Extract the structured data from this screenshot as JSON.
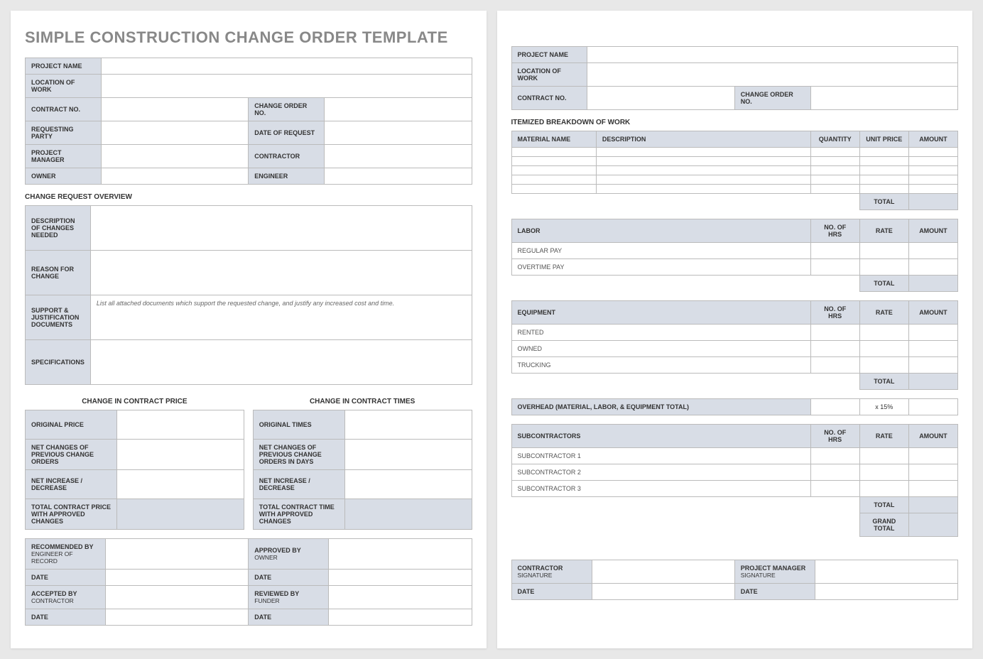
{
  "title": "SIMPLE CONSTRUCTION CHANGE ORDER TEMPLATE",
  "p1": {
    "projname": "PROJECT NAME",
    "loc": "LOCATION OF WORK",
    "contractno": "CONTRACT NO.",
    "changeno": "CHANGE ORDER NO.",
    "reqparty": "REQUESTING PARTY",
    "datereq": "DATE OF REQUEST",
    "pm": "PROJECT MANAGER",
    "contractor": "CONTRACTOR",
    "owner": "OWNER",
    "engineer": "ENGINEER"
  },
  "ov": {
    "h": "CHANGE REQUEST OVERVIEW",
    "desc": "DESCRIPTION OF CHANGES NEEDED",
    "reason": "REASON FOR CHANGE",
    "support": "SUPPORT & JUSTIFICATION DOCUMENTS",
    "supporthint": "List all attached documents which support the requested change, and justify any increased cost and time.",
    "spec": "SPECIFICATIONS"
  },
  "price": {
    "h": "CHANGE IN CONTRACT PRICE",
    "orig": "ORIGINAL PRICE",
    "net": "NET CHANGES OF PREVIOUS CHANGE ORDERS",
    "inc": "NET INCREASE / DECREASE",
    "tot": "TOTAL CONTRACT PRICE WITH APPROVED CHANGES"
  },
  "time": {
    "h": "CHANGE IN CONTRACT TIMES",
    "orig": "ORIGINAL TIMES",
    "net": "NET CHANGES OF PREVIOUS CHANGE ORDERS IN DAYS",
    "inc": "NET INCREASE / DECREASE",
    "tot": "TOTAL CONTRACT TIME WITH APPROVED CHANGES"
  },
  "sig": {
    "rec": "RECOMMENDED BY",
    "recsub": "ENGINEER OF RECORD",
    "app": "APPROVED BY",
    "appsub": "OWNER",
    "acc": "ACCEPTED BY",
    "accsub": "CONTRACTOR",
    "rev": "REVIEWED BY",
    "revsub": "FUNDER",
    "date": "DATE"
  },
  "p2": {
    "projname": "PROJECT NAME",
    "loc": "LOCATION OF WORK",
    "contractno": "CONTRACT NO.",
    "changeno": "CHANGE ORDER NO."
  },
  "it": {
    "h": "ITEMIZED BREAKDOWN OF WORK",
    "mat": "MATERIAL NAME",
    "desc": "DESCRIPTION",
    "qty": "QUANTITY",
    "unit": "UNIT PRICE",
    "amt": "AMOUNT",
    "total": "TOTAL",
    "labor": "LABOR",
    "hrs": "NO. OF HRS",
    "rate": "RATE",
    "reg": "REGULAR PAY",
    "ot": "OVERTIME PAY",
    "equip": "EQUIPMENT",
    "rented": "RENTED",
    "owned": "OWNED",
    "truck": "TRUCKING",
    "ovh": "OVERHEAD (MATERIAL, LABOR, & EQUIPMENT TOTAL)",
    "ovhrate": "x 15%",
    "subs": "SUBCONTRACTORS",
    "s1": "SUBCONTRACTOR 1",
    "s2": "SUBCONTRACTOR 2",
    "s3": "SUBCONTRACTOR 3",
    "grand": "GRAND TOTAL"
  },
  "sig2": {
    "con": "CONTRACTOR",
    "pm": "PROJECT MANAGER",
    "sig": "SIGNATURE",
    "date": "DATE"
  }
}
